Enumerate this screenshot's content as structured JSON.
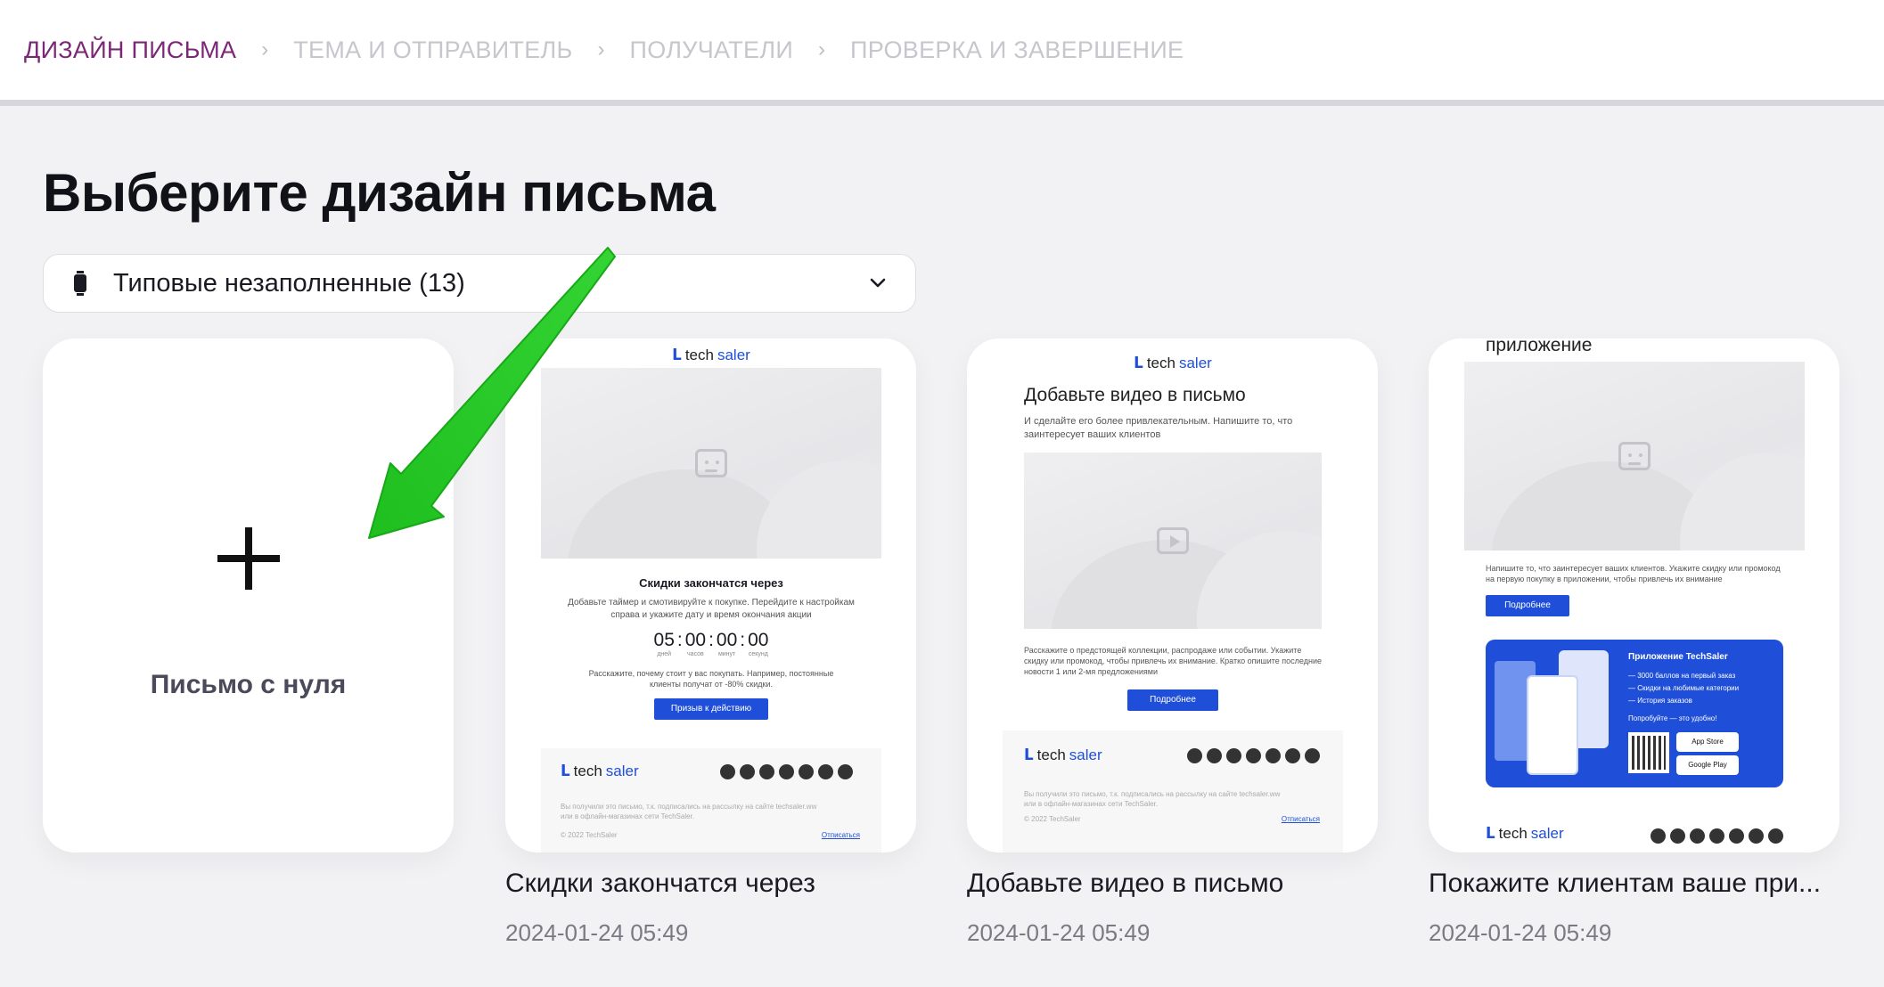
{
  "steps": [
    {
      "label": "ДИЗАЙН ПИСЬМА",
      "active": true
    },
    {
      "label": "ТЕМА И ОТПРАВИТЕЛЬ"
    },
    {
      "label": "ПОЛУЧАТЕЛИ"
    },
    {
      "label": "ПРОВЕРКА И ЗАВЕРШЕНИЕ"
    }
  ],
  "page_title": "Выберите дизайн письма",
  "category_select": {
    "value": "Типовые незаполненные (13)"
  },
  "blank_card": {
    "label": "Письмо с нуля"
  },
  "logo": {
    "part1": "tech",
    "part2": "saler"
  },
  "templates": [
    {
      "caption": "Скидки закончатся через",
      "date": "2024-01-24 05:49",
      "heading": "Скидки закончатся через",
      "intro": "Добавьте таймер и смотивируйте к покупке. Перейдите к настройкам справа и укажите дату и время окончания акции",
      "timer": {
        "days": "05",
        "hours": "00",
        "minutes": "00",
        "seconds": "00",
        "days_label": "дней",
        "hours_label": "часов",
        "minutes_label": "минут",
        "seconds_label": "секунд"
      },
      "body": "Расскажите, почему стоит у вас покупать. Например, постоянные клиенты получат от -80% скидки.",
      "button": "Призыв к действию",
      "footer_note": "Вы получили это письмо, т.к. подписались на рассылку на сайте techsaler.ww или в офлайн-магазинах сети TechSaler.",
      "copyright": "© 2022 TechSaler",
      "unsubscribe": "Отписаться"
    },
    {
      "caption": "Добавьте видео в письмо",
      "date": "2024-01-24 05:49",
      "heading": "Добавьте видео в письмо",
      "intro": "И сделайте его более привлекательным. Напишите то, что заинтересует ваших клиентов",
      "body": "Расскажите о предстоящей коллекции, распродаже или событии. Укажите скидку или промокод, чтобы привлечь их внимание. Кратко опишите последние новости 1 или 2-мя предложениями",
      "button": "Подробнее",
      "footer_note": "Вы получили это письмо, т.к. подписались на рассылку на сайте techsaler.ww или в офлайн-магазинах сети TechSaler.",
      "copyright": "© 2022 TechSaler",
      "unsubscribe": "Отписаться"
    },
    {
      "caption": "Покажите клиентам ваше при...",
      "date": "2024-01-24 05:49",
      "heading": "приложение",
      "intro": "Напишите то, что заинтересует ваших клиентов. Укажите скидку или промокод на первую покупку в приложении, чтобы привлечь их внимание",
      "button": "Подробнее",
      "app_title": "Приложение TechSaler",
      "app_bullets": [
        "3000 баллов на первый заказ",
        "Скидки на любимые категории",
        "История заказов"
      ],
      "app_try": "Попробуйте — это удобно!",
      "store1": "App Store",
      "store2": "Google Play"
    }
  ]
}
